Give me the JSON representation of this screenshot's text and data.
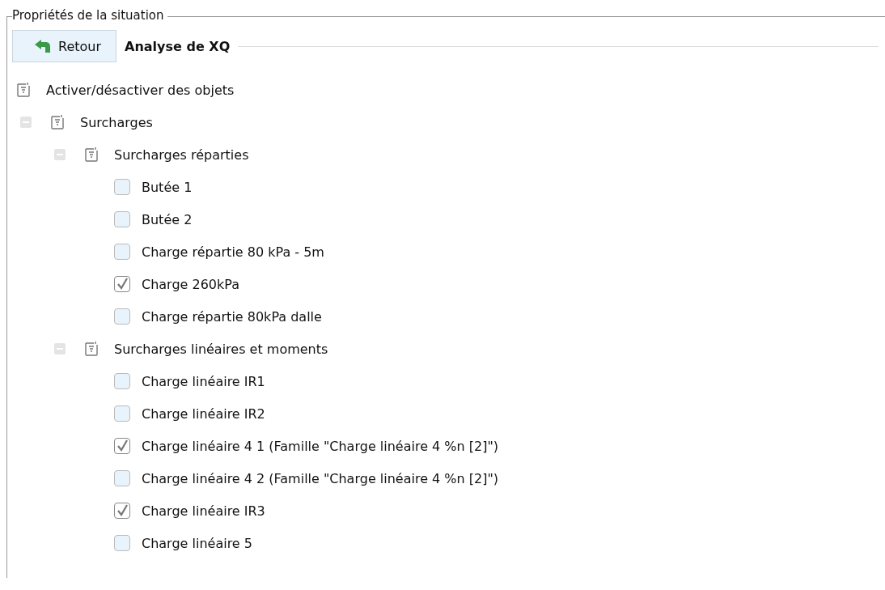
{
  "group_title": "Propriétés de la situation",
  "back_button": {
    "label": "Retour"
  },
  "heading": "Analyse de XQ",
  "tree": [
    {
      "kind": "group",
      "label": "Activer/désactiver des objets",
      "children": [
        {
          "kind": "group",
          "label": "Surcharges",
          "expanded": true,
          "children": [
            {
              "kind": "group",
              "label": "Surcharges réparties",
              "expanded": true,
              "children": [
                {
                  "kind": "check",
                  "label": "Butée 1",
                  "checked": false
                },
                {
                  "kind": "check",
                  "label": "Butée 2",
                  "checked": false
                },
                {
                  "kind": "check",
                  "label": "Charge répartie 80 kPa - 5m",
                  "checked": false
                },
                {
                  "kind": "check",
                  "label": "Charge 260kPa",
                  "checked": true
                },
                {
                  "kind": "check",
                  "label": "Charge répartie 80kPa dalle",
                  "checked": false
                }
              ]
            },
            {
              "kind": "group",
              "label": "Surcharges linéaires et moments",
              "expanded": true,
              "children": [
                {
                  "kind": "check",
                  "label": "Charge linéaire IR1",
                  "checked": false
                },
                {
                  "kind": "check",
                  "label": "Charge linéaire IR2",
                  "checked": false
                },
                {
                  "kind": "check",
                  "label": "Charge linéaire 4 1 (Famille \"Charge linéaire 4 %n [2]\")",
                  "checked": true
                },
                {
                  "kind": "check",
                  "label": "Charge linéaire 4 2 (Famille \"Charge linéaire 4 %n [2]\")",
                  "checked": false
                },
                {
                  "kind": "check",
                  "label": "Charge linéaire IR3",
                  "checked": true
                },
                {
                  "kind": "check",
                  "label": "Charge linéaire 5",
                  "checked": false
                }
              ]
            }
          ]
        }
      ]
    }
  ]
}
